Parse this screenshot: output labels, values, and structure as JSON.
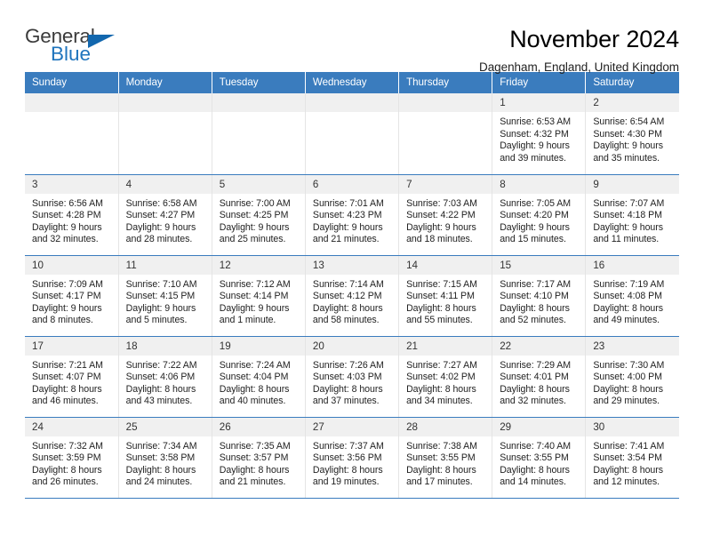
{
  "brand": {
    "name_part1": "General",
    "name_part2": "Blue",
    "accent_color": "#1267ae"
  },
  "header": {
    "title": "November 2024",
    "subtitle": "Dagenham, England, United Kingdom"
  },
  "calendar": {
    "header_color": "#3a7cbe",
    "daynum_band_color": "#f0f0f0",
    "weekdays": [
      "Sunday",
      "Monday",
      "Tuesday",
      "Wednesday",
      "Thursday",
      "Friday",
      "Saturday"
    ],
    "labels": {
      "sunrise": "Sunrise:",
      "sunset": "Sunset:",
      "daylight": "Daylight:"
    },
    "weeks": [
      [
        {
          "empty": true
        },
        {
          "empty": true
        },
        {
          "empty": true
        },
        {
          "empty": true
        },
        {
          "empty": true
        },
        {
          "day": "1",
          "sunrise": "Sunrise: 6:53 AM",
          "sunset": "Sunset: 4:32 PM",
          "daylight1": "Daylight: 9 hours",
          "daylight2": "and 39 minutes."
        },
        {
          "day": "2",
          "sunrise": "Sunrise: 6:54 AM",
          "sunset": "Sunset: 4:30 PM",
          "daylight1": "Daylight: 9 hours",
          "daylight2": "and 35 minutes."
        }
      ],
      [
        {
          "day": "3",
          "sunrise": "Sunrise: 6:56 AM",
          "sunset": "Sunset: 4:28 PM",
          "daylight1": "Daylight: 9 hours",
          "daylight2": "and 32 minutes."
        },
        {
          "day": "4",
          "sunrise": "Sunrise: 6:58 AM",
          "sunset": "Sunset: 4:27 PM",
          "daylight1": "Daylight: 9 hours",
          "daylight2": "and 28 minutes."
        },
        {
          "day": "5",
          "sunrise": "Sunrise: 7:00 AM",
          "sunset": "Sunset: 4:25 PM",
          "daylight1": "Daylight: 9 hours",
          "daylight2": "and 25 minutes."
        },
        {
          "day": "6",
          "sunrise": "Sunrise: 7:01 AM",
          "sunset": "Sunset: 4:23 PM",
          "daylight1": "Daylight: 9 hours",
          "daylight2": "and 21 minutes."
        },
        {
          "day": "7",
          "sunrise": "Sunrise: 7:03 AM",
          "sunset": "Sunset: 4:22 PM",
          "daylight1": "Daylight: 9 hours",
          "daylight2": "and 18 minutes."
        },
        {
          "day": "8",
          "sunrise": "Sunrise: 7:05 AM",
          "sunset": "Sunset: 4:20 PM",
          "daylight1": "Daylight: 9 hours",
          "daylight2": "and 15 minutes."
        },
        {
          "day": "9",
          "sunrise": "Sunrise: 7:07 AM",
          "sunset": "Sunset: 4:18 PM",
          "daylight1": "Daylight: 9 hours",
          "daylight2": "and 11 minutes."
        }
      ],
      [
        {
          "day": "10",
          "sunrise": "Sunrise: 7:09 AM",
          "sunset": "Sunset: 4:17 PM",
          "daylight1": "Daylight: 9 hours",
          "daylight2": "and 8 minutes."
        },
        {
          "day": "11",
          "sunrise": "Sunrise: 7:10 AM",
          "sunset": "Sunset: 4:15 PM",
          "daylight1": "Daylight: 9 hours",
          "daylight2": "and 5 minutes."
        },
        {
          "day": "12",
          "sunrise": "Sunrise: 7:12 AM",
          "sunset": "Sunset: 4:14 PM",
          "daylight1": "Daylight: 9 hours",
          "daylight2": "and 1 minute."
        },
        {
          "day": "13",
          "sunrise": "Sunrise: 7:14 AM",
          "sunset": "Sunset: 4:12 PM",
          "daylight1": "Daylight: 8 hours",
          "daylight2": "and 58 minutes."
        },
        {
          "day": "14",
          "sunrise": "Sunrise: 7:15 AM",
          "sunset": "Sunset: 4:11 PM",
          "daylight1": "Daylight: 8 hours",
          "daylight2": "and 55 minutes."
        },
        {
          "day": "15",
          "sunrise": "Sunrise: 7:17 AM",
          "sunset": "Sunset: 4:10 PM",
          "daylight1": "Daylight: 8 hours",
          "daylight2": "and 52 minutes."
        },
        {
          "day": "16",
          "sunrise": "Sunrise: 7:19 AM",
          "sunset": "Sunset: 4:08 PM",
          "daylight1": "Daylight: 8 hours",
          "daylight2": "and 49 minutes."
        }
      ],
      [
        {
          "day": "17",
          "sunrise": "Sunrise: 7:21 AM",
          "sunset": "Sunset: 4:07 PM",
          "daylight1": "Daylight: 8 hours",
          "daylight2": "and 46 minutes."
        },
        {
          "day": "18",
          "sunrise": "Sunrise: 7:22 AM",
          "sunset": "Sunset: 4:06 PM",
          "daylight1": "Daylight: 8 hours",
          "daylight2": "and 43 minutes."
        },
        {
          "day": "19",
          "sunrise": "Sunrise: 7:24 AM",
          "sunset": "Sunset: 4:04 PM",
          "daylight1": "Daylight: 8 hours",
          "daylight2": "and 40 minutes."
        },
        {
          "day": "20",
          "sunrise": "Sunrise: 7:26 AM",
          "sunset": "Sunset: 4:03 PM",
          "daylight1": "Daylight: 8 hours",
          "daylight2": "and 37 minutes."
        },
        {
          "day": "21",
          "sunrise": "Sunrise: 7:27 AM",
          "sunset": "Sunset: 4:02 PM",
          "daylight1": "Daylight: 8 hours",
          "daylight2": "and 34 minutes."
        },
        {
          "day": "22",
          "sunrise": "Sunrise: 7:29 AM",
          "sunset": "Sunset: 4:01 PM",
          "daylight1": "Daylight: 8 hours",
          "daylight2": "and 32 minutes."
        },
        {
          "day": "23",
          "sunrise": "Sunrise: 7:30 AM",
          "sunset": "Sunset: 4:00 PM",
          "daylight1": "Daylight: 8 hours",
          "daylight2": "and 29 minutes."
        }
      ],
      [
        {
          "day": "24",
          "sunrise": "Sunrise: 7:32 AM",
          "sunset": "Sunset: 3:59 PM",
          "daylight1": "Daylight: 8 hours",
          "daylight2": "and 26 minutes."
        },
        {
          "day": "25",
          "sunrise": "Sunrise: 7:34 AM",
          "sunset": "Sunset: 3:58 PM",
          "daylight1": "Daylight: 8 hours",
          "daylight2": "and 24 minutes."
        },
        {
          "day": "26",
          "sunrise": "Sunrise: 7:35 AM",
          "sunset": "Sunset: 3:57 PM",
          "daylight1": "Daylight: 8 hours",
          "daylight2": "and 21 minutes."
        },
        {
          "day": "27",
          "sunrise": "Sunrise: 7:37 AM",
          "sunset": "Sunset: 3:56 PM",
          "daylight1": "Daylight: 8 hours",
          "daylight2": "and 19 minutes."
        },
        {
          "day": "28",
          "sunrise": "Sunrise: 7:38 AM",
          "sunset": "Sunset: 3:55 PM",
          "daylight1": "Daylight: 8 hours",
          "daylight2": "and 17 minutes."
        },
        {
          "day": "29",
          "sunrise": "Sunrise: 7:40 AM",
          "sunset": "Sunset: 3:55 PM",
          "daylight1": "Daylight: 8 hours",
          "daylight2": "and 14 minutes."
        },
        {
          "day": "30",
          "sunrise": "Sunrise: 7:41 AM",
          "sunset": "Sunset: 3:54 PM",
          "daylight1": "Daylight: 8 hours",
          "daylight2": "and 12 minutes."
        }
      ]
    ]
  }
}
